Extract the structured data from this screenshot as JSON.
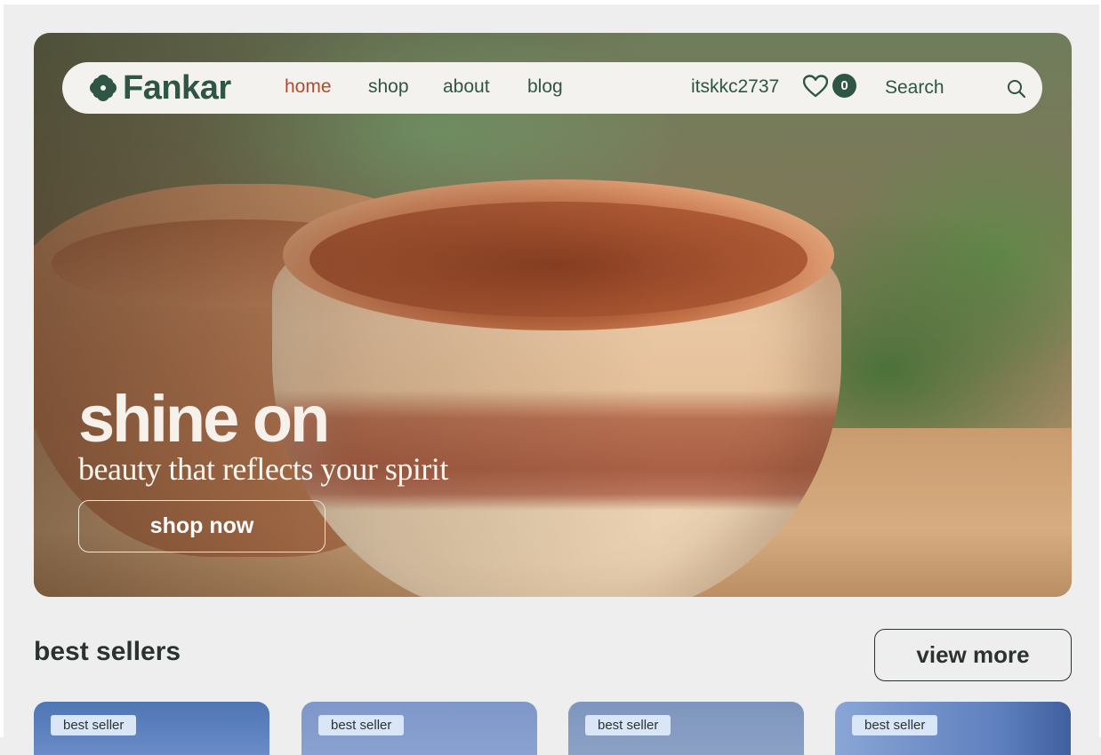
{
  "nav": {
    "brand": "Fankar",
    "links": [
      "home",
      "shop",
      "about",
      "blog"
    ],
    "active": "home",
    "username": "itskkc2737",
    "wishlist_count": "0",
    "search_placeholder": "Search"
  },
  "hero": {
    "title": "shine on",
    "subtitle": "beauty that reflects your spirit",
    "cta_label": "shop now"
  },
  "best_sellers": {
    "title": "best sellers",
    "view_more_label": "view more",
    "products": [
      {
        "badge": "best seller",
        "color": "#4f75b3"
      },
      {
        "badge": "best seller",
        "color": "#7e97c9"
      },
      {
        "badge": "best seller",
        "color": "#7d95bd"
      },
      {
        "badge": "best seller",
        "color": "#5e7fbe"
      }
    ]
  },
  "colors": {
    "brand_green": "#2f5546",
    "accent_rust": "#b5492c",
    "background": "#eeeeee"
  }
}
